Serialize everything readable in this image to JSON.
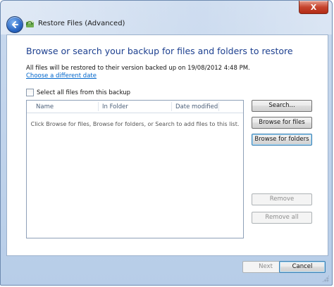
{
  "window": {
    "title": "Restore Files (Advanced)",
    "close_label": "X"
  },
  "content": {
    "main_instruction": "Browse or search your backup for files and folders to restore",
    "info_text": "All files will be restored to their version backed up on 19/08/2012 4:48 PM.",
    "change_date_link": "Choose a different date",
    "select_all_label": "Select all files from this backup",
    "select_all_checked": false
  },
  "list": {
    "columns": [
      "Name",
      "In Folder",
      "Date modified"
    ],
    "empty_message": "Click Browse for files, Browse for folders, or Search to add files to this list."
  },
  "side_buttons": {
    "search": "Search...",
    "browse_files": "Browse for files",
    "browse_folders": "Browse for folders",
    "remove": "Remove",
    "remove_all": "Remove all"
  },
  "footer": {
    "next": "Next",
    "cancel": "Cancel"
  },
  "icons": {
    "back": "back-arrow-icon",
    "app": "restore-files-icon",
    "close": "close-icon",
    "grip": "resize-grip-icon"
  },
  "colors": {
    "title_bar": "#c9d9ee",
    "instruction_text": "#1c3f8f",
    "link": "#0066cc",
    "close_button": "#c6452e"
  }
}
